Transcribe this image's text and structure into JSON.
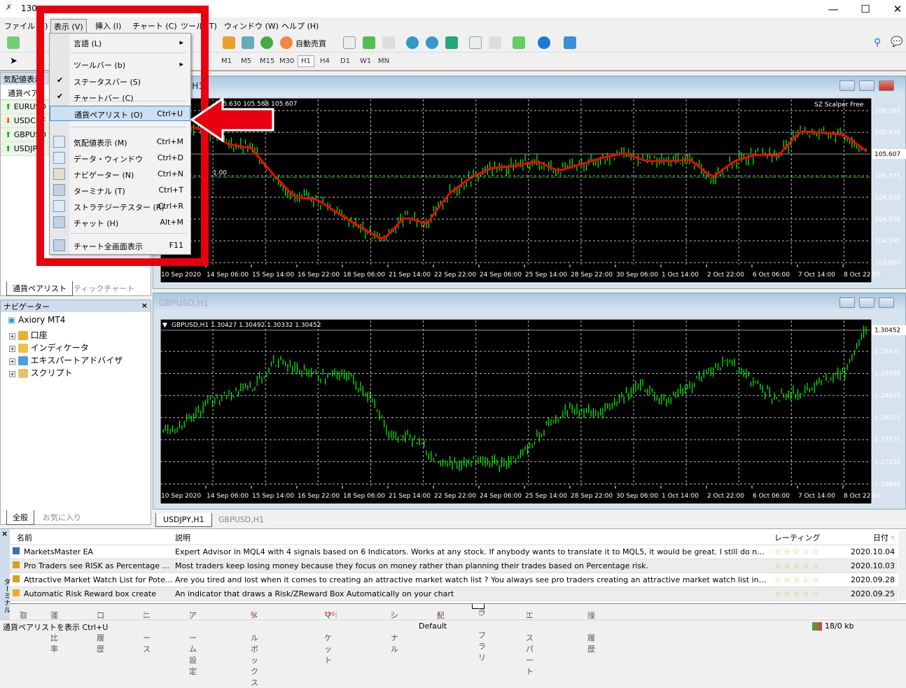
{
  "window": {
    "title": "130",
    "minimize": "—",
    "maximize": "☐",
    "close": "✕"
  },
  "menubar": [
    "ファイル (F)",
    "表示 (V)",
    "挿入 (I)",
    "チャート (C)",
    "ツール (T)",
    "ウィンドウ (W)",
    "ヘルプ (H)"
  ],
  "toolbar": {
    "auto_trade": "自動売買",
    "timeframes": [
      "M1",
      "M5",
      "M15",
      "M30",
      "H1",
      "H4",
      "D1",
      "W1",
      "MN"
    ],
    "active_timeframe": "H1"
  },
  "view_menu": {
    "items": [
      {
        "label": "言語 (L)",
        "shortcut": "",
        "submenu": true
      },
      {
        "label": "ツールバー (b)",
        "shortcut": "",
        "submenu": true
      },
      {
        "label": "ステータスバー (S)",
        "shortcut": "",
        "checked": true
      },
      {
        "label": "チャートバー (C)",
        "shortcut": "",
        "checked": true
      },
      {
        "label": "通貨ペアリスト (O)",
        "shortcut": "Ctrl+U",
        "highlighted": true
      },
      {
        "label": "気配値表示 (M)",
        "shortcut": "Ctrl+M"
      },
      {
        "label": "データ・ウィンドウ",
        "shortcut": "Ctrl+D"
      },
      {
        "label": "ナビゲーター (N)",
        "shortcut": "Ctrl+N"
      },
      {
        "label": "ターミナル (T)",
        "shortcut": "Ctrl+T"
      },
      {
        "label": "ストラテジーテスター (R)",
        "shortcut": "Ctrl+R"
      },
      {
        "label": "チャット (H)",
        "shortcut": "Alt+M"
      },
      {
        "label": "チャート全画面表示",
        "shortcut": "F11"
      }
    ],
    "check": "✔",
    "arrow": "▸"
  },
  "annotation": {
    "color": "#e8000f"
  },
  "market_watch": {
    "title": "気配値表示",
    "column": "通貨ペア",
    "rows": [
      {
        "symbol": "EURUSD",
        "dir": "up"
      },
      {
        "symbol": "USDCHF",
        "dir": "down"
      },
      {
        "symbol": "GBPUSD",
        "dir": "up"
      },
      {
        "symbol": "USDJPY",
        "dir": "up"
      }
    ],
    "tabs": [
      "通貨ペアリスト",
      "ティックチャート"
    ]
  },
  "navigator": {
    "title": "ナビゲーター",
    "root": "Axiory MT4",
    "items": [
      "口座",
      "インディケータ",
      "エキスパートアドバイザ",
      "スクリプト"
    ],
    "tabs": [
      "全般",
      "お気に入り"
    ]
  },
  "charts": [
    {
      "title": "USDJPY,H1",
      "info": "105.630 105.588 105.607",
      "indicator": "SZ Scalper Free",
      "level_label": "1.00",
      "current": "105.607",
      "yticks": [
        "106.265",
        "105.935",
        "105.275",
        "104.950",
        "104.620",
        "104.290",
        "103.960"
      ],
      "xticks": [
        "10 Sep 2020",
        "14 Sep 06:00",
        "15 Sep 14:00",
        "16 Sep 22:00",
        "18 Sep 06:00",
        "21 Sep 14:00",
        "22 Sep 22:00",
        "24 Sep 06:00",
        "25 Sep 14:00",
        "28 Sep 22:00",
        "30 Sep 06:00",
        "1 Oct 14:00",
        "2 Oct 22:00",
        "6 Oct 06:00",
        "7 Oct 14:00",
        "8 Oct 22:00"
      ],
      "ylim": [
        103.93,
        106.35
      ],
      "closes": [
        106.0,
        106.05,
        105.95,
        105.75,
        105.7,
        105.3,
        104.95,
        104.92,
        104.7,
        104.5,
        104.3,
        104.65,
        104.55,
        105.0,
        105.25,
        105.4,
        105.42,
        105.5,
        105.35,
        105.45,
        105.55,
        105.62,
        105.5,
        105.5,
        105.52,
        105.25,
        105.5,
        105.6,
        105.58,
        105.95,
        105.93,
        105.9,
        105.65
      ],
      "ma_color": "#ff0000",
      "bar_color": "#00ff00"
    },
    {
      "title": "GBPUSD,H1",
      "info": "GBPUSD,H1  1.30427 1.30492 1.30332 1.30452",
      "current": "1.30452",
      "yticks": [
        "1.29935",
        "1.29395",
        "1.28855",
        "1.28315",
        "1.27775",
        "1.27235",
        "1.26695"
      ],
      "xticks": [
        "10 Sep 2020",
        "14 Sep 06:00",
        "15 Sep 14:00",
        "16 Sep 22:00",
        "18 Sep 06:00",
        "21 Sep 14:00",
        "22 Sep 22:00",
        "24 Sep 06:00",
        "25 Sep 14:00",
        "28 Sep 22:00",
        "30 Sep 06:00",
        "1 Oct 14:00",
        "2 Oct 22:00",
        "6 Oct 06:00",
        "7 Oct 14:00",
        "8 Oct 22:00"
      ],
      "ylim": [
        1.2665,
        1.3055
      ],
      "closes": [
        1.28,
        1.282,
        1.287,
        1.289,
        1.291,
        1.297,
        1.295,
        1.293,
        1.294,
        1.289,
        1.279,
        1.278,
        1.273,
        1.272,
        1.273,
        1.271,
        1.275,
        1.282,
        1.285,
        1.284,
        1.287,
        1.291,
        1.287,
        1.29,
        1.294,
        1.297,
        1.292,
        1.288,
        1.289,
        1.292,
        1.294,
        1.3045
      ],
      "bar_color": "#00ff00"
    }
  ],
  "chart_tabs": [
    "USDJPY,H1",
    "GBPUSD,H1"
  ],
  "terminal": {
    "side_label": "ターミナル",
    "columns": [
      "名前",
      "説明",
      "レーティング",
      "日付"
    ],
    "rows": [
      {
        "name": "MarketsMaster EA",
        "desc": "Expert Advisor in MQL4 with 4 signals based on 6 Indicators. Works at any stock. If anybody wants to translate it to MQL5, it would be great. I still do not know ...",
        "rating": 2.5,
        "date": "2020.10.04"
      },
      {
        "name": "Pro Traders see RISK as Percentage ...",
        "desc": "Most traders keep losing money because they focus on money rather than planning their trades based on Percentage risk.",
        "rating": 4,
        "date": "2020.10.03"
      },
      {
        "name": "Attractive Market Watch List for Pote...",
        "desc": "Are you tired and lost when it comes to creating an attractive market watch list ? You always see pro traders creating an attractive market watch list in which the...",
        "rating": 3.5,
        "date": "2020.09.28"
      },
      {
        "name": "Automatic Risk Reward box create",
        "desc": "An indicator that draws a Risk/ZReward Box Automatically on your chart",
        "rating": 4,
        "date": "2020.09.25"
      }
    ],
    "tabs": [
      {
        "label": "取引"
      },
      {
        "label": "運用比率"
      },
      {
        "label": "口座履歴"
      },
      {
        "label": "ニュース"
      },
      {
        "label": "アラーム設定"
      },
      {
        "label": "メールボックス",
        "badge": "8"
      },
      {
        "label": "マーケット",
        "badge": "119"
      },
      {
        "label": "シグナル"
      },
      {
        "label": "記事",
        "badge": "4"
      },
      {
        "label": "ライブラリ",
        "active": true
      },
      {
        "label": "エキスパート"
      },
      {
        "label": "操作履歴"
      }
    ]
  },
  "status": {
    "hint": "通貨ペアリストを表示 Ctrl+U",
    "profile": "Default",
    "traffic": "18/0 kb"
  }
}
